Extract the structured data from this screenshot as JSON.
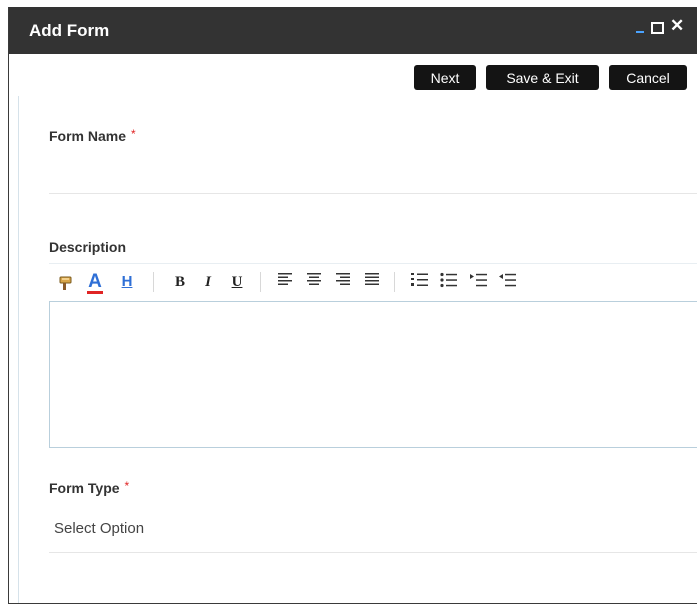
{
  "dialog": {
    "title": "Add Form",
    "window_controls": {
      "minimize": "–",
      "maximize": "□",
      "close": "✕"
    }
  },
  "actions": {
    "next": "Next",
    "save_exit": "Save & Exit",
    "cancel": "Cancel"
  },
  "form": {
    "form_name": {
      "label": "Form Name",
      "required_marker": "*",
      "value": ""
    },
    "description": {
      "label": "Description",
      "toolbar": {
        "bold": "B",
        "italic": "I",
        "underline": "U",
        "font_color": "A",
        "highlight": "H"
      },
      "value": ""
    },
    "form_type": {
      "label": "Form Type",
      "required_marker": "*",
      "selected": "Select Option"
    }
  },
  "colors": {
    "titlebar": "#333333",
    "button": "#141414",
    "required": "#e02424",
    "editor_border": "#b9cfdc",
    "font_color_icon": "#2f6fd6"
  }
}
